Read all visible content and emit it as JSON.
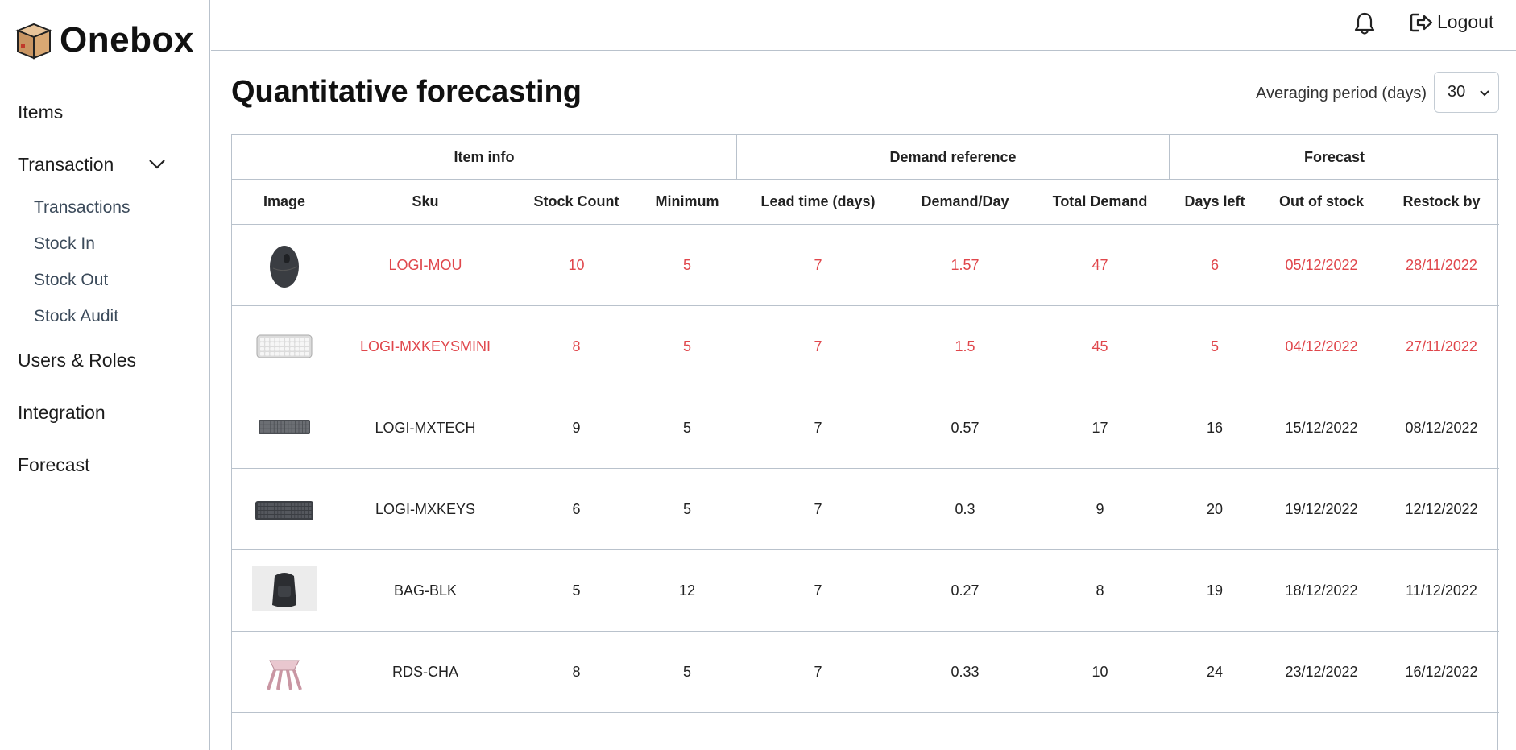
{
  "brand": {
    "name": "Onebox"
  },
  "sidebar": {
    "items": [
      {
        "label": "Items"
      },
      {
        "label": "Transaction"
      },
      {
        "label": "Users & Roles"
      },
      {
        "label": "Integration"
      },
      {
        "label": "Forecast"
      }
    ],
    "transaction_sub": [
      {
        "label": "Transactions"
      },
      {
        "label": "Stock In"
      },
      {
        "label": "Stock Out"
      },
      {
        "label": "Stock Audit"
      }
    ]
  },
  "topbar": {
    "logout_label": "Logout"
  },
  "page": {
    "title": "Quantitative forecasting",
    "averaging_label": "Averaging period (days)",
    "averaging_value": "30"
  },
  "table": {
    "groups": [
      "Item info",
      "Demand reference",
      "Forecast"
    ],
    "columns": [
      "Image",
      "Sku",
      "Stock Count",
      "Minimum",
      "Lead time (days)",
      "Demand/Day",
      "Total Demand",
      "Days left",
      "Out of stock",
      "Restock by"
    ],
    "rows": [
      {
        "image": "mouse",
        "alert": true,
        "cells": [
          "LOGI-MOU",
          "10",
          "5",
          "7",
          "1.57",
          "47",
          "6",
          "05/12/2022",
          "28/11/2022"
        ]
      },
      {
        "image": "keyboard-mini",
        "alert": true,
        "cells": [
          "LOGI-MXKEYSMINI",
          "8",
          "5",
          "7",
          "1.5",
          "45",
          "5",
          "04/12/2022",
          "27/11/2022"
        ]
      },
      {
        "image": "keyboard-mech",
        "alert": false,
        "cells": [
          "LOGI-MXTECH",
          "9",
          "5",
          "7",
          "0.57",
          "17",
          "16",
          "15/12/2022",
          "08/12/2022"
        ]
      },
      {
        "image": "keyboard",
        "alert": false,
        "cells": [
          "LOGI-MXKEYS",
          "6",
          "5",
          "7",
          "0.3",
          "9",
          "20",
          "19/12/2022",
          "12/12/2022"
        ]
      },
      {
        "image": "backpack",
        "alert": false,
        "cells": [
          "BAG-BLK",
          "5",
          "12",
          "7",
          "0.27",
          "8",
          "19",
          "18/12/2022",
          "11/12/2022"
        ]
      },
      {
        "image": "stool",
        "alert": false,
        "cells": [
          "RDS-CHA",
          "8",
          "5",
          "7",
          "0.33",
          "10",
          "24",
          "23/12/2022",
          "16/12/2022"
        ]
      }
    ]
  }
}
